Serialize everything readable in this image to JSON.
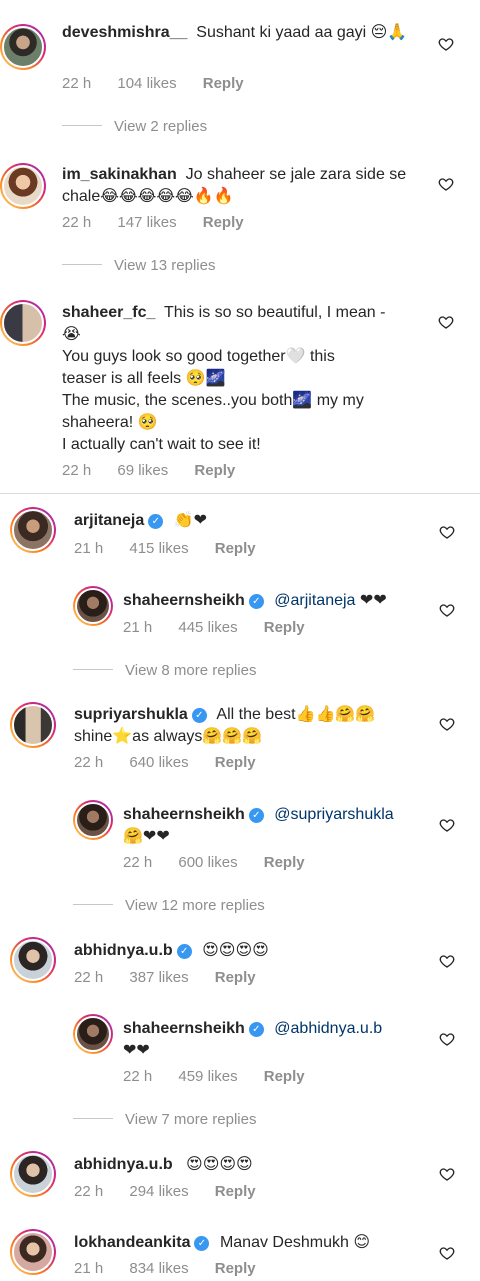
{
  "colors": {
    "username": "#262626",
    "meta": "#8e8e8e",
    "mention": "#003569",
    "verified": "#3897f0"
  },
  "icons": {
    "like": "heart-outline-icon",
    "verified": "verified-badge-icon"
  },
  "comments": [
    {
      "username": "deveshmishra__",
      "text": "Sushant ki yaad aa gayi 😔🙏",
      "time": "22 h",
      "likes": "104 likes",
      "reply": "Reply",
      "view_replies": "View 2 replies"
    },
    {
      "username": "im_sakinakhan",
      "text": "Jo shaheer se jale zara side se chale😂😂😂😂😂🔥🔥",
      "time": "22 h",
      "likes": "147 likes",
      "reply": "Reply",
      "view_replies": "View 13 replies"
    },
    {
      "username": "shaheer_fc_",
      "text_lines": [
        "This is so so beautiful, I mean -",
        "😭",
        "You guys look so good together🤍 this",
        "teaser is all feels 🥺🌌",
        "The music, the scenes..you both🌌 my my",
        "shaheera! 🥺",
        "I actually can't wait to see it!"
      ],
      "time": "22 h",
      "likes": "69 likes",
      "reply": "Reply"
    },
    {
      "username": "arjitaneja",
      "text": "👏❤",
      "time": "21 h",
      "likes": "415 likes",
      "reply": "Reply",
      "reply_item": {
        "username": "shaheernsheikh",
        "mention": "@arjitaneja",
        "text": "❤❤",
        "time": "21 h",
        "likes": "445 likes",
        "reply": "Reply"
      },
      "view_replies": "View 8 more replies"
    },
    {
      "username": "supriyarshukla",
      "text": "All the best👍👍🤗🤗",
      "text2": "shine⭐as always🤗🤗🤗",
      "time": "22 h",
      "likes": "640 likes",
      "reply": "Reply",
      "reply_item": {
        "username": "shaheernsheikh",
        "mention": "@supriyarshukla",
        "text": "🤗❤❤",
        "time": "22 h",
        "likes": "600 likes",
        "reply": "Reply"
      },
      "view_replies": "View 12 more replies"
    },
    {
      "username": "abhidnya.u.b",
      "text": "😍😍😍😍",
      "time": "22 h",
      "likes": "387 likes",
      "reply": "Reply",
      "reply_item": {
        "username": "shaheernsheikh",
        "mention": "@abhidnya.u.b",
        "text": "❤❤",
        "time": "22 h",
        "likes": "459 likes",
        "reply": "Reply"
      },
      "view_replies": "View 7 more replies"
    },
    {
      "username": "abhidnya.u.b",
      "text": "😍😍😍😍",
      "time": "22 h",
      "likes": "294 likes",
      "reply": "Reply"
    },
    {
      "username": "lokhandeankita",
      "text": "Manav Deshmukh 😊",
      "time": "21 h",
      "likes": "834 likes",
      "reply": "Reply"
    }
  ]
}
